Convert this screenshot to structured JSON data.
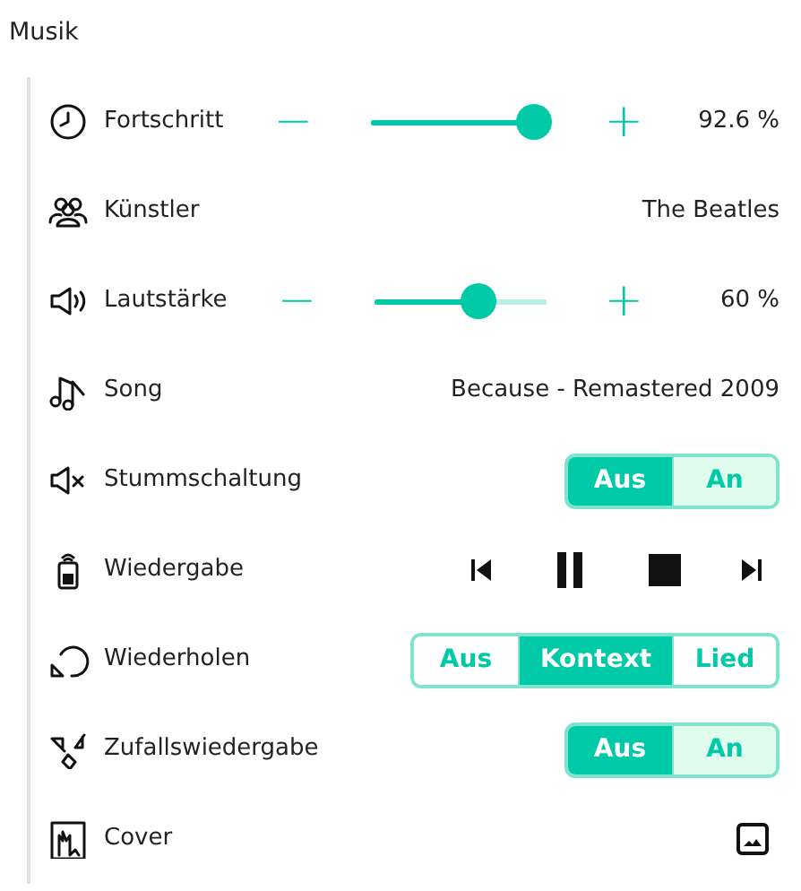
{
  "title": "Musik",
  "rows": [
    {
      "kind": "slider",
      "label": "Fortschritt",
      "minus": "−",
      "plus": "+",
      "level": 0.926,
      "reading": "92.6 %"
    },
    {
      "kind": "text",
      "label": "Künstler",
      "value": "The Beatles"
    },
    {
      "kind": "slider",
      "label": "Lautstärke",
      "minus": "−",
      "plus": "+",
      "level": 0.6,
      "reading": "60 %"
    },
    {
      "kind": "text",
      "label": "Song",
      "value": "Because - Remastered 2009"
    },
    {
      "kind": "segments",
      "label": "Stummschaltung",
      "options": [
        {
          "label": "Aus",
          "selected": true
        },
        {
          "label": "An",
          "selected": false
        }
      ]
    },
    {
      "kind": "media",
      "label": "Wiedergabe",
      "playing": true
    },
    {
      "kind": "segments",
      "label": "Wiederholen",
      "options": [
        {
          "label": "Aus",
          "selected": false
        },
        {
          "label": "Kontext",
          "selected": true
        },
        {
          "label": "Lied",
          "selected": false
        }
      ]
    },
    {
      "kind": "segments",
      "label": "Zufallswiedergabe",
      "options": [
        {
          "label": "Aus",
          "selected": true
        },
        {
          "label": "An",
          "selected": false
        }
      ]
    },
    {
      "kind": "image",
      "label": "Cover"
    }
  ]
}
